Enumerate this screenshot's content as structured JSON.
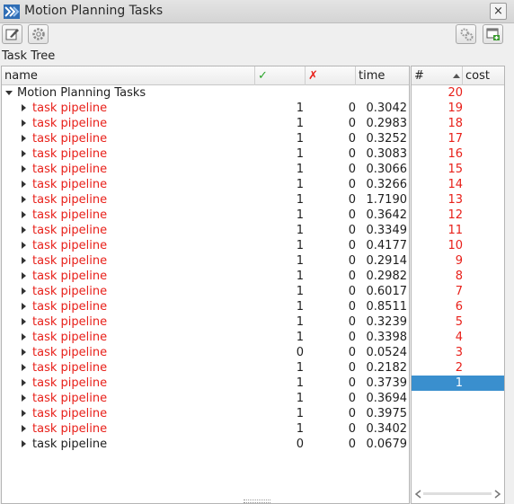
{
  "window": {
    "title": "Motion Planning Tasks",
    "close_label": "×"
  },
  "section_label": "Task Tree",
  "tree": {
    "columns": {
      "name": "name",
      "ok": "✓",
      "fail": "✗",
      "time": "time"
    },
    "root": {
      "label": "Motion Planning Tasks"
    },
    "rows": [
      {
        "label": "task pipeline",
        "ok": "1",
        "fail": "0",
        "time": "0.3042",
        "color": "#e8201a"
      },
      {
        "label": "task pipeline",
        "ok": "1",
        "fail": "0",
        "time": "0.2983",
        "color": "#e8201a"
      },
      {
        "label": "task pipeline",
        "ok": "1",
        "fail": "0",
        "time": "0.3252",
        "color": "#e8201a"
      },
      {
        "label": "task pipeline",
        "ok": "1",
        "fail": "0",
        "time": "0.3083",
        "color": "#e8201a"
      },
      {
        "label": "task pipeline",
        "ok": "1",
        "fail": "0",
        "time": "0.3066",
        "color": "#e8201a"
      },
      {
        "label": "task pipeline",
        "ok": "1",
        "fail": "0",
        "time": "0.3266",
        "color": "#e8201a"
      },
      {
        "label": "task pipeline",
        "ok": "1",
        "fail": "0",
        "time": "1.7190",
        "color": "#e8201a"
      },
      {
        "label": "task pipeline",
        "ok": "1",
        "fail": "0",
        "time": "0.3642",
        "color": "#e8201a"
      },
      {
        "label": "task pipeline",
        "ok": "1",
        "fail": "0",
        "time": "0.3349",
        "color": "#e8201a"
      },
      {
        "label": "task pipeline",
        "ok": "1",
        "fail": "0",
        "time": "0.4177",
        "color": "#e8201a"
      },
      {
        "label": "task pipeline",
        "ok": "1",
        "fail": "0",
        "time": "0.2914",
        "color": "#e8201a"
      },
      {
        "label": "task pipeline",
        "ok": "1",
        "fail": "0",
        "time": "0.2982",
        "color": "#e8201a"
      },
      {
        "label": "task pipeline",
        "ok": "1",
        "fail": "0",
        "time": "0.6017",
        "color": "#e8201a"
      },
      {
        "label": "task pipeline",
        "ok": "1",
        "fail": "0",
        "time": "0.8511",
        "color": "#e8201a"
      },
      {
        "label": "task pipeline",
        "ok": "1",
        "fail": "0",
        "time": "0.3239",
        "color": "#e8201a"
      },
      {
        "label": "task pipeline",
        "ok": "1",
        "fail": "0",
        "time": "0.3398",
        "color": "#e8201a"
      },
      {
        "label": "task pipeline",
        "ok": "0",
        "fail": "0",
        "time": "0.0524",
        "color": "#e8201a"
      },
      {
        "label": "task pipeline",
        "ok": "1",
        "fail": "0",
        "time": "0.2182",
        "color": "#e8201a"
      },
      {
        "label": "task pipeline",
        "ok": "1",
        "fail": "0",
        "time": "0.3739",
        "color": "#e8201a"
      },
      {
        "label": "task pipeline",
        "ok": "1",
        "fail": "0",
        "time": "0.3694",
        "color": "#e8201a"
      },
      {
        "label": "task pipeline",
        "ok": "1",
        "fail": "0",
        "time": "0.3975",
        "color": "#e8201a"
      },
      {
        "label": "task pipeline",
        "ok": "1",
        "fail": "0",
        "time": "0.3402",
        "color": "#e8201a"
      },
      {
        "label": "task pipeline",
        "ok": "0",
        "fail": "0",
        "time": "0.0679",
        "color": "#1e1e1e"
      }
    ]
  },
  "solutions": {
    "columns": {
      "num": "#",
      "cost": "cost"
    },
    "items": [
      "20",
      "19",
      "18",
      "17",
      "16",
      "15",
      "14",
      "13",
      "12",
      "11",
      "10",
      "9",
      "8",
      "7",
      "6",
      "5",
      "4",
      "3",
      "2",
      "1"
    ],
    "selected": "1"
  },
  "colors": {
    "ok_check": "#2aa52a",
    "fail_cross": "#e8201a",
    "failed_text": "#e8201a",
    "selection": "#3a8fce"
  }
}
